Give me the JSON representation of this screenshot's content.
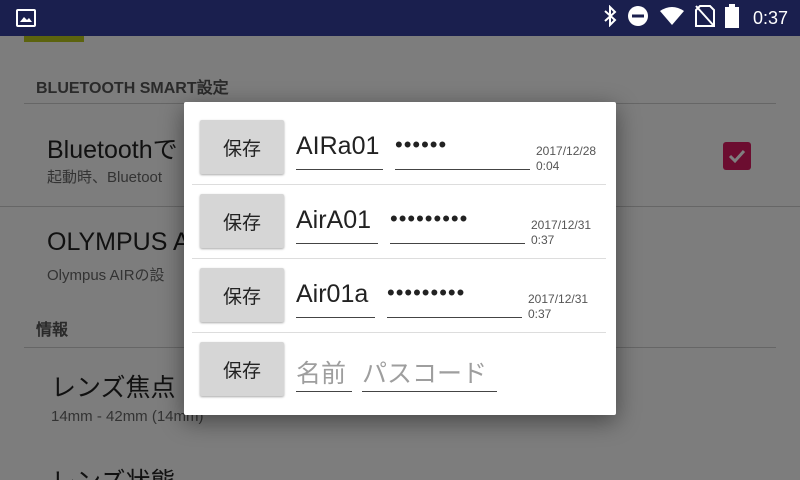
{
  "status_bar": {
    "time": "0:37",
    "icons": [
      "gallery-icon",
      "bluetooth-icon",
      "do-not-disturb-icon",
      "wifi-icon",
      "no-sim-icon",
      "battery-icon"
    ]
  },
  "settings": {
    "section_bluetooth": "BLUETOOTH SMART設定",
    "bt_item_title": "Bluetoothで",
    "bt_item_sub": "起動時、Bluetoot",
    "bt_checked": true,
    "olympus_item_title": "OLYMPUS A",
    "olympus_item_sub": "Olympus AIRの設",
    "section_info": "情報",
    "lens_focal_title": "レンズ焦点",
    "lens_focal_sub": "14mm -  42mm (14mm)",
    "lens_state_title": "レンズ状態"
  },
  "dialog": {
    "rows": [
      {
        "save_label": "保存",
        "name": "AIRa01",
        "passcode": "••••••",
        "date": "2017/12/28",
        "time": "0:04"
      },
      {
        "save_label": "保存",
        "name": "AirA01",
        "passcode": "•••••••••",
        "date": "2017/12/31",
        "time": "0:37"
      },
      {
        "save_label": "保存",
        "name": "Air01a",
        "passcode": "•••••••••",
        "date": "2017/12/31",
        "time": "0:37"
      }
    ],
    "new_row": {
      "save_label": "保存",
      "name_placeholder": "名前",
      "passcode_placeholder": "パスコード"
    }
  },
  "colors": {
    "status_bar": "#1a1f4e",
    "checkbox": "#d81b60",
    "accent": "#b8c61c"
  }
}
